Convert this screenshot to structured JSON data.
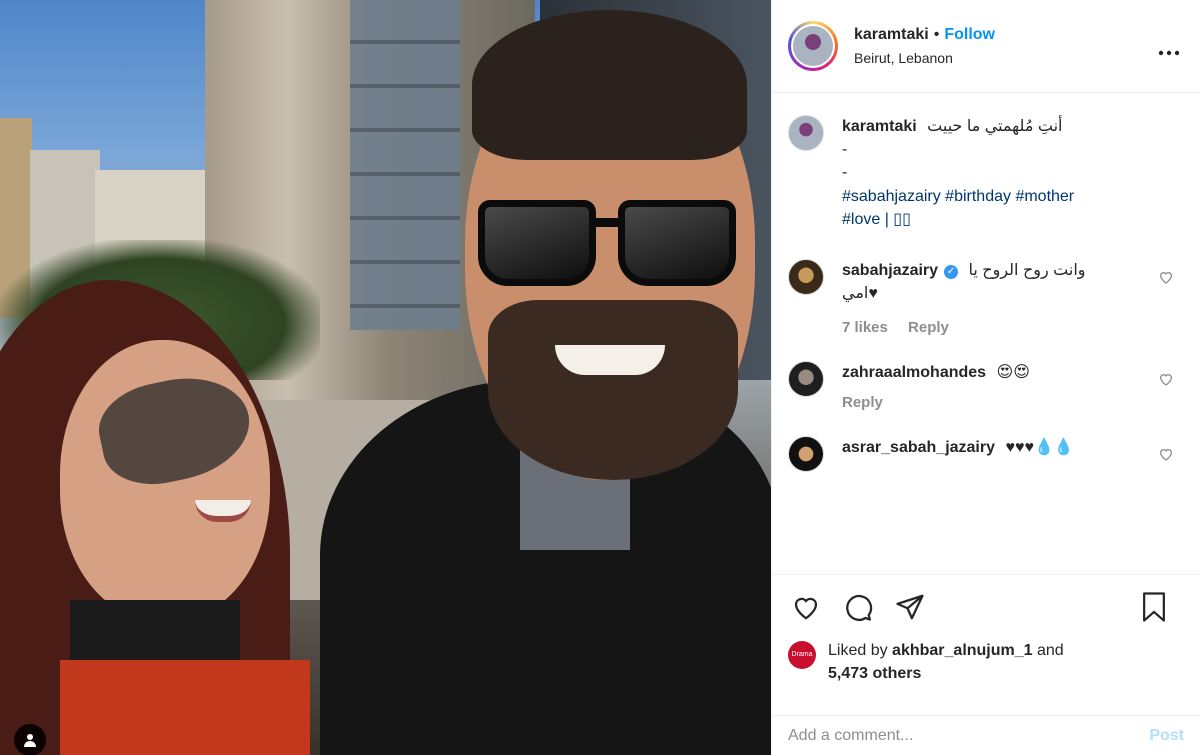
{
  "post": {
    "username": "karamtaki",
    "separator": "•",
    "follow_label": "Follow",
    "location": "Beirut, Lebanon",
    "more_label": "•••"
  },
  "caption": {
    "username": "karamtaki",
    "text": "أنتِ مُلهمتي ما حييت",
    "line2": "-",
    "line3": "-",
    "hashtags": "#sabahjazairy #birthday #mother",
    "hashtags2": "#love | ▯▯"
  },
  "comments": [
    {
      "username": "sabahjazairy",
      "verified": true,
      "text": "وانت روح الروح يا",
      "text2": "امي♥",
      "likes": "7 likes",
      "reply": "Reply"
    },
    {
      "username": "zahraaalmohandes",
      "verified": false,
      "text": "😍😍",
      "reply": "Reply"
    },
    {
      "username": "asrar_sabah_jazairy",
      "verified": false,
      "text": "♥♥♥💧💧"
    }
  ],
  "likes": {
    "prefix": "Liked by",
    "user": "akhbar_alnujum_1",
    "and": "and",
    "others": "5,473 others",
    "avatar_text": "Drama"
  },
  "add_comment": {
    "placeholder": "Add a comment...",
    "post_label": "Post"
  },
  "colors": {
    "accent": "#0095f6",
    "hashtag": "#00376b",
    "muted": "#8e8e8e",
    "post_disabled": "#b2dffc"
  },
  "icons": [
    "heart-icon",
    "comment-icon",
    "share-icon",
    "bookmark-icon",
    "more-icon",
    "user-tag-icon",
    "verified-badge-icon"
  ]
}
